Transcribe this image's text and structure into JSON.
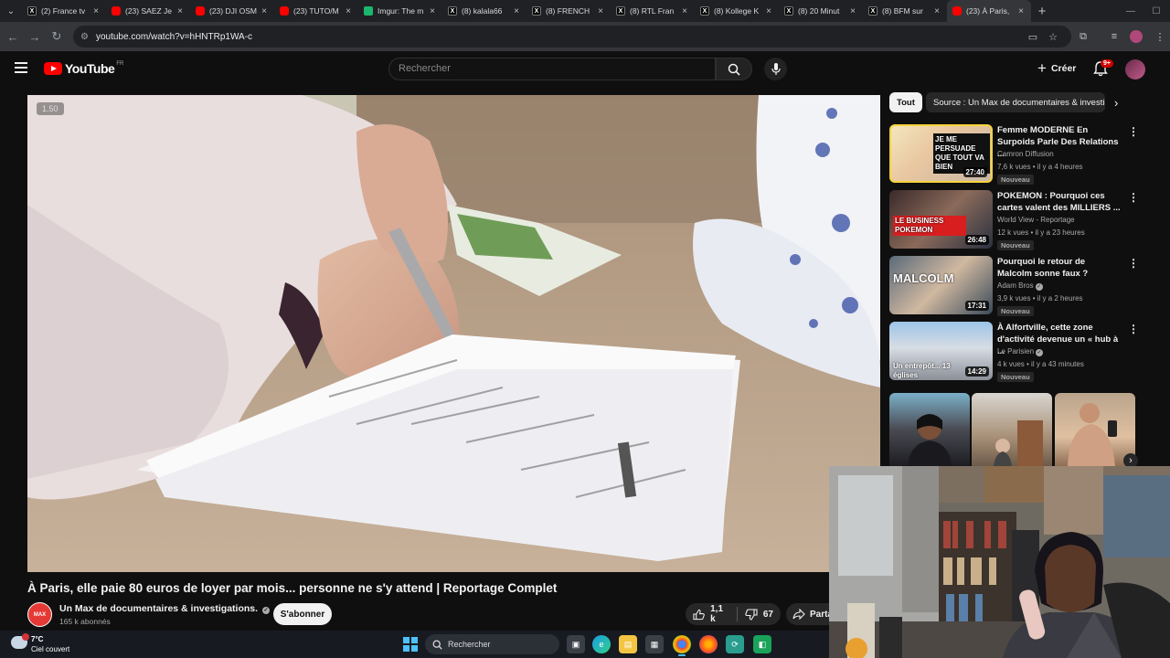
{
  "browser": {
    "tabs": [
      {
        "title": "(2) France tv",
        "icon": "x-icon"
      },
      {
        "title": "(23) SAEZ Je",
        "icon": "youtube-icon"
      },
      {
        "title": "(23) DJI OSM",
        "icon": "youtube-icon"
      },
      {
        "title": "(23) TUTO/M",
        "icon": "youtube-icon"
      },
      {
        "title": "Imgur: The m",
        "icon": "imgur-icon"
      },
      {
        "title": "(8) kalala66",
        "icon": "x-icon"
      },
      {
        "title": "(8) FRENCH",
        "icon": "x-icon"
      },
      {
        "title": "(8) RTL Fran",
        "icon": "x-icon"
      },
      {
        "title": "(8) Kollege K",
        "icon": "x-icon"
      },
      {
        "title": "(8) 20 Minut",
        "icon": "x-icon"
      },
      {
        "title": "(8) BFM sur",
        "icon": "x-icon"
      },
      {
        "title": "(23) À Paris,",
        "icon": "youtube-icon",
        "active": true
      }
    ],
    "url": "youtube.com/watch?v=hHNTRp1WA-c"
  },
  "header": {
    "logo": "YouTube",
    "country": "FR",
    "search_placeholder": "Rechercher",
    "create_label": "Créer",
    "notif_badge": "9+"
  },
  "video": {
    "speed_badge": "1.50",
    "title": "À Paris, elle paie 80 euros de loyer par mois... personne ne s'y attend | Reportage Complet",
    "channel": "Un Max de documentaires & investigations.",
    "subscribers": "165 k abonnés",
    "subscribe_label": "S'abonner",
    "likes": "1,1 k",
    "dislikes": "67",
    "share_label": "Partager",
    "channel_avatar_text": "MAX"
  },
  "sidebar": {
    "chips": [
      "Tout",
      "Source : Un Max de documentaires & investigations."
    ],
    "recommendations": [
      {
        "title": "Femme MODERNE En Surpoids Parle Des Relations ...",
        "channel": "Camron Diffusion",
        "verified": false,
        "meta": "7,6 k vues • il y a 4 heures",
        "badge": "Nouveau",
        "duration": "27:40",
        "thumb_text": "JE ME PERSUADE QUE TOUT VA BIEN"
      },
      {
        "title": "POKEMON : Pourquoi ces cartes valent des MILLIERS ...",
        "channel": "World View - Reportage",
        "verified": false,
        "meta": "12 k vues • il y a 23 heures",
        "badge": "Nouveau",
        "duration": "26:48",
        "thumb_text": "LE BUSINESS POKEMON"
      },
      {
        "title": "Pourquoi le retour de Malcolm sonne faux ?",
        "channel": "Adam Bros",
        "verified": true,
        "meta": "3,9 k vues • il y a 2 heures",
        "badge": "Nouveau",
        "duration": "17:31",
        "thumb_text": "MALCOLM"
      },
      {
        "title": "À Alfortville, cette zone d'activité devenue un « hub à ...",
        "channel": "Le Parisien",
        "verified": true,
        "meta": "4 k vues • il y a 43 minutes",
        "badge": "Nouveau",
        "duration": "14:29",
        "thumb_text": "Un entrepôt... 13 églises"
      }
    ]
  },
  "taskbar": {
    "temperature": "7°C",
    "weather": "Ciel couvert",
    "search_label": "Rechercher"
  }
}
